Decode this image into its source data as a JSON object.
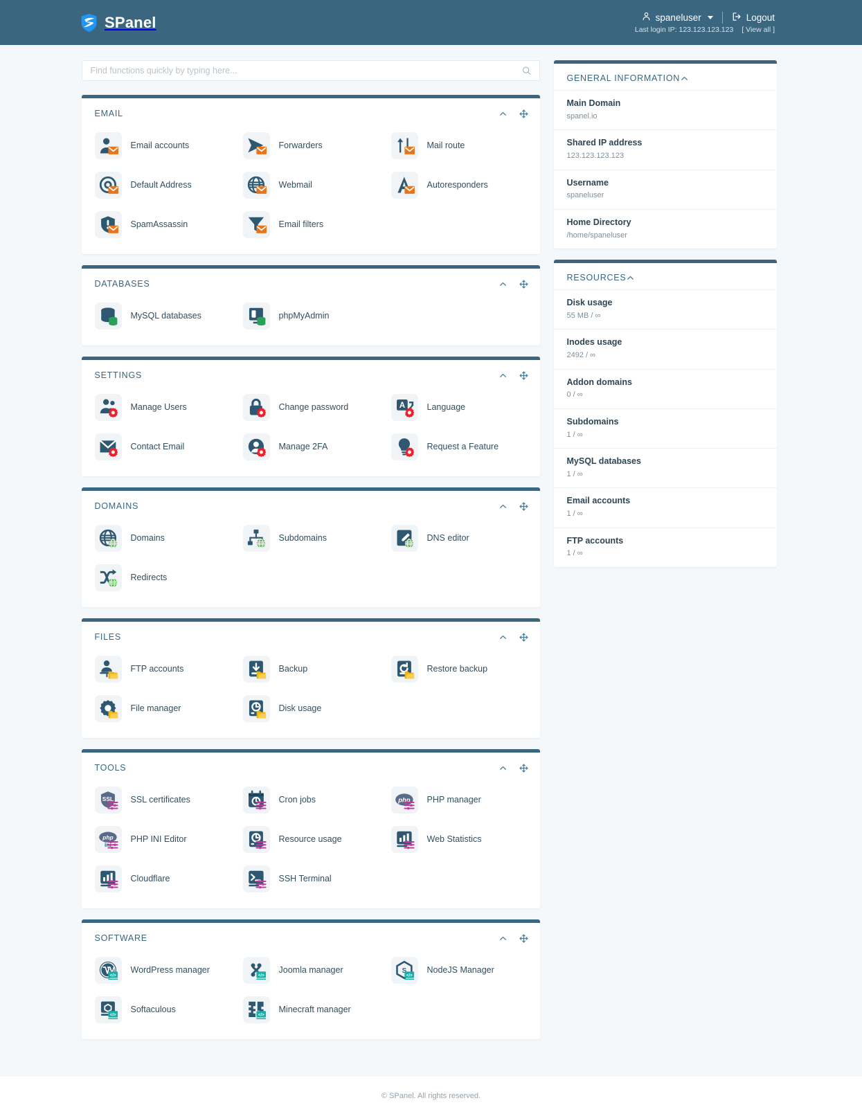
{
  "header": {
    "brand": "SPanel",
    "username": "spaneluser",
    "logout_label": "Logout",
    "last_login_label": "Last login IP: 123.123.123.123",
    "view_all_label": "[ View all ]"
  },
  "search": {
    "placeholder": "Find functions quickly by typing here...",
    "value": ""
  },
  "colors": {
    "header_bg": "#3b6680",
    "accent": "#3b6680",
    "badge_email": "#e8751a",
    "badge_database": "#2aa05a",
    "badge_settings": "#e8232c",
    "badge_domain": "#52b848",
    "badge_file": "#f2b30d",
    "badge_tool": "#c0389a",
    "badge_software": "#1ab0a8"
  },
  "sections": [
    {
      "id": "email",
      "title": "EMAIL",
      "badge": "envelope",
      "badge_color": "#e8751a",
      "items": [
        {
          "label": "Email accounts",
          "icon": "user-icon"
        },
        {
          "label": "Forwarders",
          "icon": "forward-arrow-icon"
        },
        {
          "label": "Mail route",
          "icon": "route-arrows-icon"
        },
        {
          "label": "Default Address",
          "icon": "at-sign-icon"
        },
        {
          "label": "Webmail",
          "icon": "globe-icon"
        },
        {
          "label": "Autoresponders",
          "icon": "letter-a-icon"
        },
        {
          "label": "SpamAssassin",
          "icon": "shield-alert-icon"
        },
        {
          "label": "Email filters",
          "icon": "funnel-icon"
        }
      ]
    },
    {
      "id": "databases",
      "title": "DATABASES",
      "badge": "database",
      "badge_color": "#2aa05a",
      "items": [
        {
          "label": "MySQL databases",
          "icon": "database-icon"
        },
        {
          "label": "phpMyAdmin",
          "icon": "monitor-db-icon"
        }
      ]
    },
    {
      "id": "settings",
      "title": "SETTINGS",
      "badge": "gear",
      "badge_color": "#e8232c",
      "items": [
        {
          "label": "Manage Users",
          "icon": "users-icon"
        },
        {
          "label": "Change password",
          "icon": "lock-icon"
        },
        {
          "label": "Language",
          "icon": "translate-icon"
        },
        {
          "label": "Contact Email",
          "icon": "envelope-icon"
        },
        {
          "label": "Manage 2FA",
          "icon": "user-circle-icon"
        },
        {
          "label": "Request a Feature",
          "icon": "lightbulb-icon"
        }
      ]
    },
    {
      "id": "domains",
      "title": "DOMAINS",
      "badge": "globe",
      "badge_color": "#52b848",
      "items": [
        {
          "label": "Domains",
          "icon": "globe-icon"
        },
        {
          "label": "Subdomains",
          "icon": "sitemap-icon"
        },
        {
          "label": "DNS editor",
          "icon": "edit-document-icon"
        },
        {
          "label": "Redirects",
          "icon": "shuffle-arrows-icon"
        }
      ]
    },
    {
      "id": "files",
      "title": "FILES",
      "badge": "folder",
      "badge_color": "#f2b30d",
      "items": [
        {
          "label": "FTP accounts",
          "icon": "user-desk-icon"
        },
        {
          "label": "Backup",
          "icon": "drive-download-icon"
        },
        {
          "label": "Restore backup",
          "icon": "drive-restore-icon"
        },
        {
          "label": "File manager",
          "icon": "gear-file-icon"
        },
        {
          "label": "Disk usage",
          "icon": "disk-icon"
        }
      ]
    },
    {
      "id": "tools",
      "title": "TOOLS",
      "badge": "sliders",
      "badge_color": "#c0389a",
      "items": [
        {
          "label": "SSL certificates",
          "icon": "ssl-shield-icon"
        },
        {
          "label": "Cron jobs",
          "icon": "calendar-clock-icon"
        },
        {
          "label": "PHP manager",
          "icon": "php-icon"
        },
        {
          "label": "PHP INI Editor",
          "icon": "php-ini-icon"
        },
        {
          "label": "Resource usage",
          "icon": "disk-gauge-icon"
        },
        {
          "label": "Web Statistics",
          "icon": "bar-chart-icon"
        },
        {
          "label": "Cloudflare",
          "icon": "bar-chart-icon"
        },
        {
          "label": "SSH Terminal",
          "icon": "terminal-icon"
        }
      ]
    },
    {
      "id": "software",
      "title": "SOFTWARE",
      "badge": "code",
      "badge_color": "#1ab0a8",
      "items": [
        {
          "label": "WordPress manager",
          "icon": "wordpress-icon"
        },
        {
          "label": "Joomla manager",
          "icon": "joomla-icon"
        },
        {
          "label": "NodeJS Manager",
          "icon": "nodejs-icon"
        },
        {
          "label": "Softaculous",
          "icon": "softaculous-icon"
        },
        {
          "label": "Minecraft manager",
          "icon": "minecraft-icon"
        }
      ]
    }
  ],
  "side_panels": [
    {
      "id": "general-information",
      "title": "GENERAL INFORMATION",
      "rows": [
        {
          "key": "Main Domain",
          "value": "spanel.io"
        },
        {
          "key": "Shared IP address",
          "value": "123.123.123.123"
        },
        {
          "key": "Username",
          "value": "spaneluser"
        },
        {
          "key": "Home Directory",
          "value": "/home/spaneluser"
        }
      ]
    },
    {
      "id": "resources",
      "title": "RESOURCES",
      "rows": [
        {
          "key": "Disk usage",
          "value": "55 MB / ∞"
        },
        {
          "key": "Inodes usage",
          "value": "2492 / ∞"
        },
        {
          "key": "Addon domains",
          "value": "0 / ∞"
        },
        {
          "key": "Subdomains",
          "value": "1 / ∞"
        },
        {
          "key": "MySQL databases",
          "value": "1 / ∞"
        },
        {
          "key": "Email accounts",
          "value": "1 / ∞"
        },
        {
          "key": "FTP accounts",
          "value": "1 / ∞"
        }
      ]
    }
  ],
  "footer": {
    "text": "© SPanel. All rights reserved."
  }
}
